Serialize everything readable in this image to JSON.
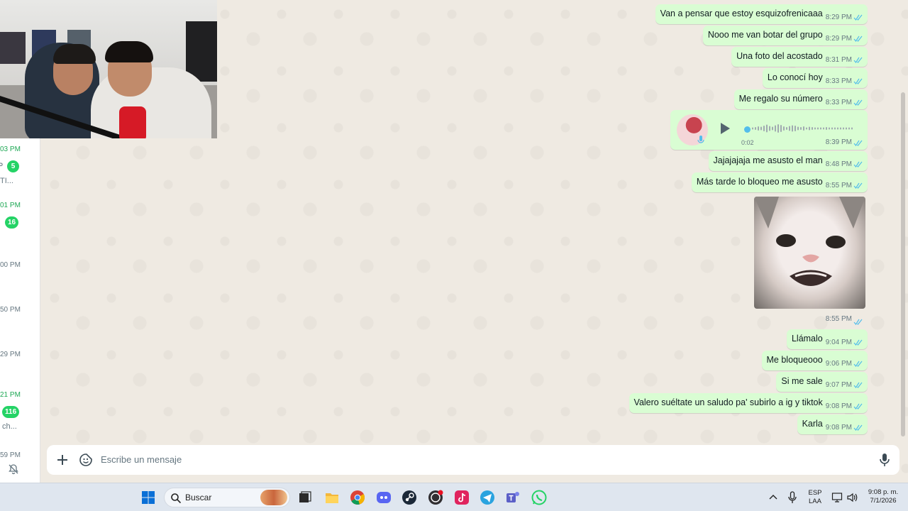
{
  "chat_list": {
    "times": [
      "03 PM",
      "01 PM",
      "00 PM",
      "50 PM",
      "29 PM",
      "21 PM",
      "59 PM"
    ],
    "badges": [
      "5",
      "16",
      "116"
    ],
    "snippets": [
      "TI...",
      "ch..."
    ]
  },
  "messages": [
    {
      "text": "Van a pensar que estoy esquizofrenicaaa",
      "time": "8:29 PM"
    },
    {
      "text": "Nooo me van botar del grupo",
      "time": "8:29 PM"
    },
    {
      "text": "Una foto del acostado",
      "time": "8:31 PM"
    },
    {
      "text": "Lo conocí hoy",
      "time": "8:33 PM"
    },
    {
      "text": "Me regalo su número",
      "time": "8:33 PM"
    },
    {
      "text": "Jajajajaja me asusto el man",
      "time": "8:48 PM"
    },
    {
      "text": "Más tarde lo bloqueo me asusto",
      "time": "8:55 PM"
    },
    {
      "text": "Llámalo",
      "time": "9:04 PM"
    },
    {
      "text": "Me bloqueooo",
      "time": "9:06 PM"
    },
    {
      "text": "Si me sale",
      "time": "9:07 PM"
    },
    {
      "text": "Valero suéltate un saludo pa' subirlo a ig y tiktok",
      "time": "9:08 PM"
    },
    {
      "text": "Karla",
      "time": "9:08 PM"
    }
  ],
  "voice_note": {
    "duration": "0:02",
    "time": "8:39 PM"
  },
  "photo_message": {
    "time": "8:55 PM"
  },
  "composer": {
    "placeholder": "Escribe un mensaje"
  },
  "taskbar": {
    "search_label": "Buscar",
    "language": "ESP",
    "layout": "LAA",
    "clock_time": "9:08 p. m.",
    "clock_date": "7/1/2026",
    "apps": [
      "windows-start-icon",
      "search-icon",
      "task-view-icon",
      "file-explorer-icon",
      "chrome-icon",
      "discord-icon",
      "steam-icon",
      "obs-icon",
      "tiktok-icon",
      "telegram-icon",
      "teams-icon",
      "whatsapp-icon"
    ]
  },
  "colors": {
    "bubble_out": "#d9fdd3",
    "chat_bg": "#efeae2",
    "read_ticks": "#53bdeb",
    "unread_badge": "#25d366"
  }
}
